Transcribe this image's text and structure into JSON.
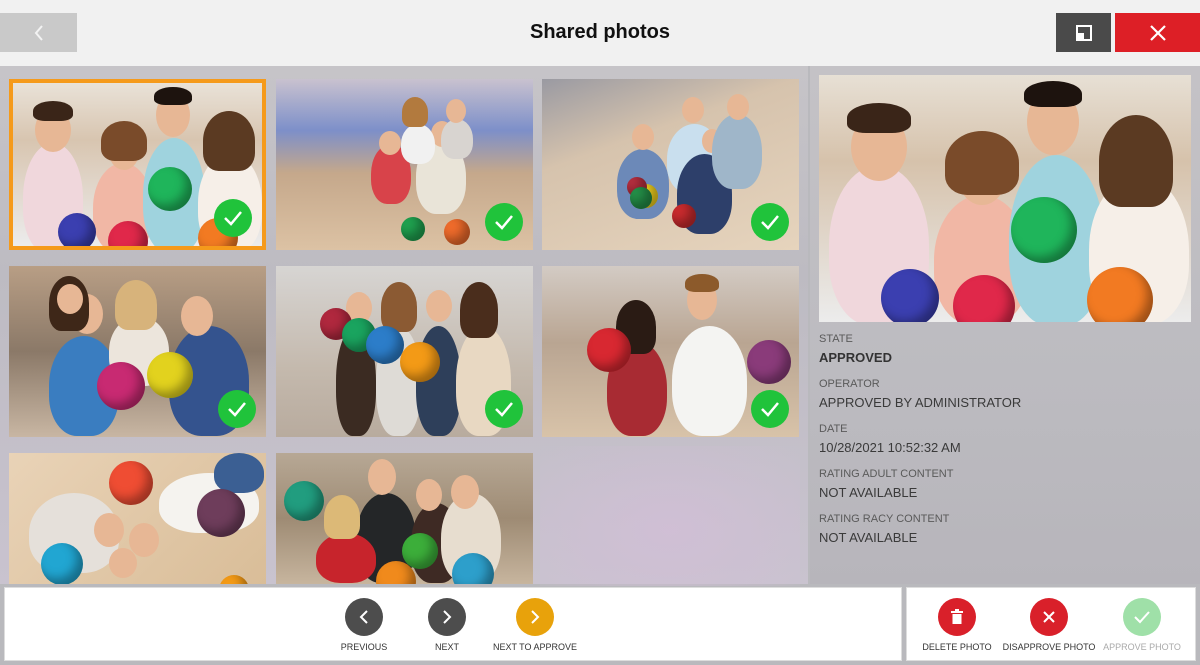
{
  "header": {
    "title": "Shared photos"
  },
  "details": {
    "state_label": "STATE",
    "state_value": "APPROVED",
    "operator_label": "OPERATOR",
    "operator_value": "APPROVED BY ADMINISTRATOR",
    "date_label": "DATE",
    "date_value": "10/28/2021 10:52:32 AM",
    "adult_label": "RATING ADULT CONTENT",
    "adult_value": "NOT AVAILABLE",
    "racy_label": "RATING RACY CONTENT",
    "racy_value": "NOT AVAILABLE"
  },
  "nav": {
    "previous_label": "PREVIOUS",
    "next_label": "NEXT",
    "next_to_approve_label": "NEXT TO APPROVE"
  },
  "actions": {
    "delete_label": "DELETE PHOTO",
    "disapprove_label": "DISAPPROVE PHOTO",
    "approve_label": "APPROVE PHOTO"
  },
  "photos": [
    {
      "approved": true,
      "selected": true
    },
    {
      "approved": true,
      "selected": false
    },
    {
      "approved": true,
      "selected": false
    },
    {
      "approved": true,
      "selected": false
    },
    {
      "approved": true,
      "selected": false
    },
    {
      "approved": true,
      "selected": false
    },
    {
      "approved": false,
      "selected": false
    },
    {
      "approved": false,
      "selected": false
    }
  ],
  "colors": {
    "accent_orange": "#f59a1b",
    "approved_green": "#20c33b",
    "close_red": "#dd1f26",
    "delete_red": "#d9202a",
    "next_to_approve": "#e8a20b"
  },
  "icons": {
    "back": "chevron-left-icon",
    "restore": "restore-window-icon",
    "close": "close-icon",
    "approved": "check-icon",
    "previous": "chevron-left-icon",
    "next": "chevron-right-icon",
    "delete": "trash-icon",
    "disapprove": "close-icon",
    "approve": "check-icon"
  }
}
